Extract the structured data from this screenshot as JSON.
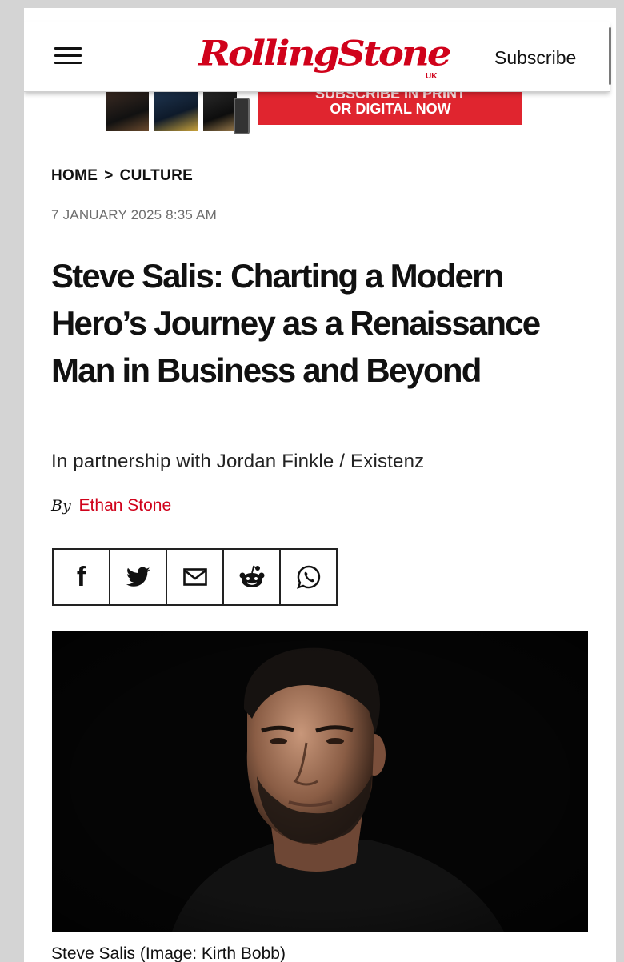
{
  "header": {
    "logo_text": "RollingStone",
    "logo_region": "UK",
    "subscribe_label": "Subscribe",
    "menu_icon": "hamburger-menu-icon"
  },
  "ad": {
    "line1": "SUBSCRIBE IN PRINT",
    "line2": "OR DIGITAL NOW"
  },
  "breadcrumb": {
    "home": "HOME",
    "separator": ">",
    "section": "CULTURE"
  },
  "article": {
    "date": "7 JANUARY 2025 8:35 AM",
    "title": "Steve Salis: Charting a Modern Hero’s Journey as a Renaissance Man in Business and Beyond",
    "partnership": "In partnership with Jordan Finkle / Existenz",
    "by_label": "By",
    "author": "Ethan Stone",
    "image_caption": "Steve Salis (Image: Kirth Bobb)"
  },
  "share": {
    "icons": [
      "facebook-icon",
      "twitter-icon",
      "email-icon",
      "reddit-icon",
      "whatsapp-icon"
    ]
  },
  "colors": {
    "brand_red": "#d0021b",
    "text": "#111111",
    "muted": "#6d6d6d",
    "page_bg": "#d4d4d4"
  }
}
